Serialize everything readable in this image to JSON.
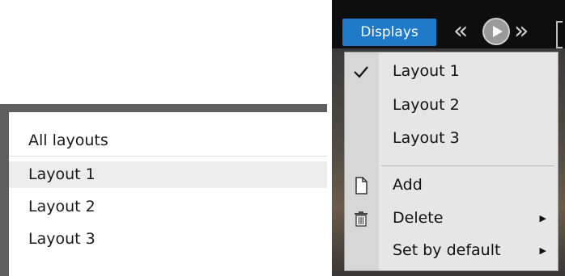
{
  "layouts_panel": {
    "header": "All layouts",
    "items": [
      {
        "label": "Layout 1",
        "selected": true
      },
      {
        "label": "Layout 2",
        "selected": false
      },
      {
        "label": "Layout 3",
        "selected": false
      }
    ]
  },
  "toolbar": {
    "displays_label": "Displays",
    "prev_icon": "«",
    "next_icon": "»"
  },
  "menu": {
    "layouts": [
      {
        "label": "Layout 1",
        "checked": true
      },
      {
        "label": "Layout 2",
        "checked": false
      },
      {
        "label": "Layout 3",
        "checked": false
      }
    ],
    "actions": [
      {
        "label": "Add",
        "icon": "document-icon",
        "has_submenu": false
      },
      {
        "label": "Delete",
        "icon": "trash-icon",
        "has_submenu": true,
        "arrow": "▶"
      },
      {
        "label": "Set by default",
        "icon": "",
        "has_submenu": true,
        "arrow": "▶"
      }
    ]
  },
  "colors": {
    "accent": "#1f7ac9",
    "menu_bg": "#e6e6e6",
    "gutter": "#d7d7d7"
  }
}
